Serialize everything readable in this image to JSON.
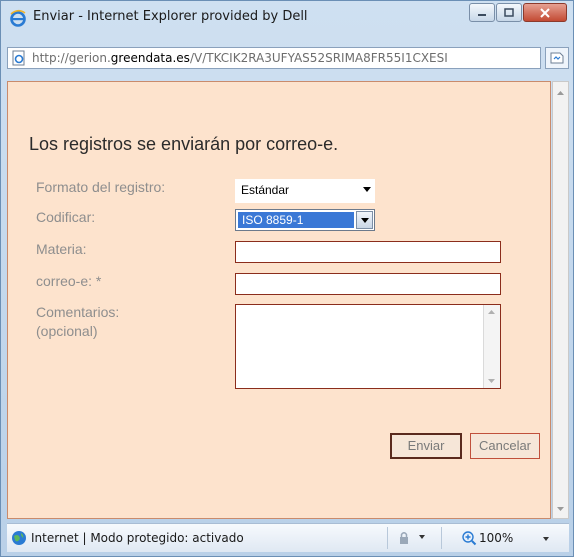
{
  "window": {
    "title": "Enviar - Internet Explorer provided by Dell"
  },
  "address": {
    "url_prefix": "http://gerion.",
    "url_domain": "greendata.es",
    "url_rest": "/V/TKCIK2RA3UFYAS52SRIMA8FR55I1CXESI"
  },
  "form": {
    "heading": "Los registros se enviarán por correo-e.",
    "format_label": "Formato del registro:",
    "format_value": "Estándar",
    "encode_label": "Codificar:",
    "encode_value": "ISO 8859-1",
    "subject_label": "Materia:",
    "subject_value": "",
    "email_label": "correo-e: *",
    "email_value": "",
    "comments_label_1": "Comentarios:",
    "comments_label_2": "(opcional)",
    "comments_value": "",
    "send_label": "Enviar",
    "cancel_label": "Cancelar"
  },
  "status": {
    "zone_text": "Internet | Modo protegido: activado",
    "zoom": "100%"
  },
  "colors": {
    "content_bg": "#fde3cd",
    "field_border": "#8b2d1c",
    "selected_highlight": "#3a78d6"
  },
  "icons": [
    "ie-logo-icon",
    "minimize-icon",
    "maximize-icon",
    "close-icon",
    "page-icon",
    "compatibility-icon",
    "globe-icon",
    "lock-icon",
    "zoom-icon"
  ]
}
